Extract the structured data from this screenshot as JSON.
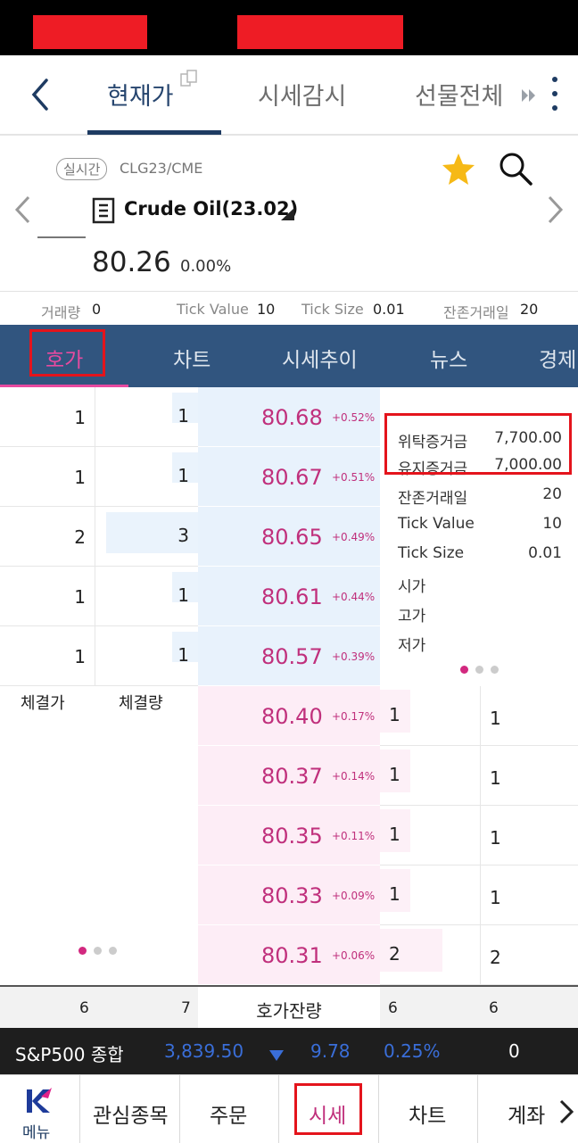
{
  "colors": {
    "navy": "#1e3b62",
    "pink": "#c0307c",
    "highlight": "#e4141c",
    "ticker_blue": "#3a6ed8"
  },
  "nav": {
    "tabs": [
      "현재가",
      "시세감시",
      "선물전체"
    ],
    "icons": [
      "back-chevron-icon",
      "copy-icon",
      "fast-forward-icon",
      "kebab-menu-icon"
    ]
  },
  "instrument": {
    "badge": "실시간",
    "code": "CLG23/CME",
    "name": "Crude Oil(23.02)",
    "price": "80.26",
    "change_pct": "0.00%"
  },
  "metrics": [
    {
      "label": "거래량",
      "value": "0"
    },
    {
      "label": "Tick Value",
      "value": "10"
    },
    {
      "label": "Tick Size",
      "value": "0.01"
    },
    {
      "label": "잔존거래일",
      "value": "20"
    }
  ],
  "subtabs": [
    "호가",
    "차트",
    "시세추이",
    "뉴스",
    "경제"
  ],
  "asks": [
    {
      "count": "1",
      "qty": "1",
      "price": "80.68",
      "pct": "+0.52%"
    },
    {
      "count": "1",
      "qty": "1",
      "price": "80.67",
      "pct": "+0.51%"
    },
    {
      "count": "2",
      "qty": "3",
      "price": "80.65",
      "pct": "+0.49%"
    },
    {
      "count": "1",
      "qty": "1",
      "price": "80.61",
      "pct": "+0.44%"
    },
    {
      "count": "1",
      "qty": "1",
      "price": "80.57",
      "pct": "+0.39%"
    }
  ],
  "bids": [
    {
      "price": "80.40",
      "pct": "+0.17%",
      "qty": "1",
      "count": "1"
    },
    {
      "price": "80.37",
      "pct": "+0.14%",
      "qty": "1",
      "count": "1"
    },
    {
      "price": "80.35",
      "pct": "+0.11%",
      "qty": "1",
      "count": "1"
    },
    {
      "price": "80.33",
      "pct": "+0.09%",
      "qty": "1",
      "count": "1"
    },
    {
      "price": "80.31",
      "pct": "+0.06%",
      "qty": "2",
      "count": "2"
    }
  ],
  "side_info": [
    {
      "label": "위탁증거금",
      "value": "7,700.00"
    },
    {
      "label": "유지증거금",
      "value": "7,000.00"
    },
    {
      "label": "잔존거래일",
      "value": "20"
    },
    {
      "label": "Tick Value",
      "value": "10"
    },
    {
      "label": "Tick Size",
      "value": "0.01"
    },
    {
      "label": "시가",
      "value": ""
    },
    {
      "label": "고가",
      "value": ""
    },
    {
      "label": "저가",
      "value": ""
    }
  ],
  "trades": {
    "price_header": "체결가",
    "qty_header": "체결량"
  },
  "totals": {
    "ask_count": "6",
    "ask_qty": "7",
    "label": "호가잔량",
    "bid_qty": "6",
    "bid_count": "6"
  },
  "ticker": {
    "name": "S&P500 종합",
    "value": "3,839.50",
    "change": "9.78",
    "pct": "0.25%",
    "extra": "0"
  },
  "bottom_nav": {
    "menu_label": "메뉴",
    "items": [
      "관심종목",
      "주문",
      "시세",
      "차트",
      "계좌"
    ]
  }
}
